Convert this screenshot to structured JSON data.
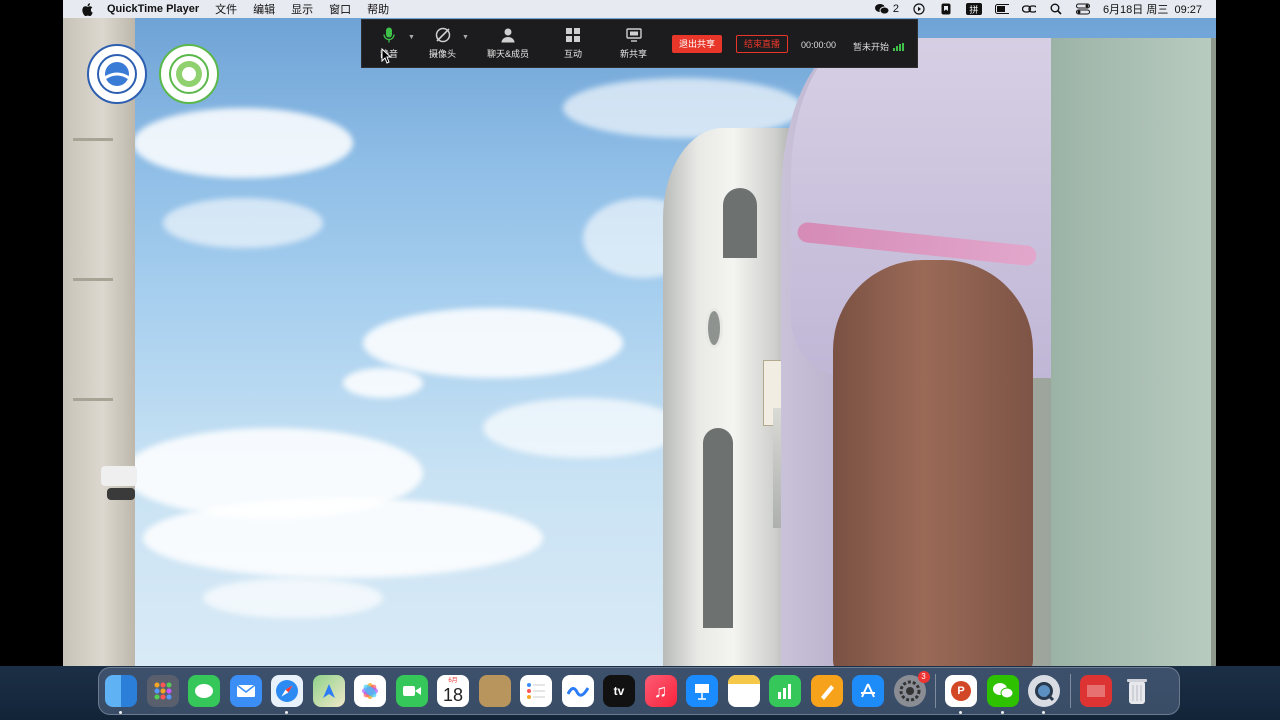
{
  "menubar": {
    "app_name": "QuickTime Player",
    "items": [
      "文件",
      "编辑",
      "显示",
      "窗口",
      "帮助"
    ],
    "status_count": "2",
    "input_method": "拼",
    "datetime": "6月18日 周三  09:27"
  },
  "toolbar": {
    "items": [
      {
        "label": "静音",
        "icon": "microphone-icon"
      },
      {
        "label": "摄像头",
        "icon": "camera-off-icon"
      },
      {
        "label": "聊天&成员",
        "icon": "person-icon"
      },
      {
        "label": "互动",
        "icon": "grid-icon"
      },
      {
        "label": "新共享",
        "icon": "screen-share-icon"
      }
    ],
    "exit_share_label": "退出共享",
    "end_live_label": "结束直播",
    "timer": "00:00:00",
    "status_text": "暂未开始",
    "accent_red": "#e8372a",
    "signal_green": "#3fc24a"
  },
  "dock": {
    "calendar_month": "6月",
    "calendar_day": "18",
    "tv_label": "tv",
    "settings_badge": "3",
    "apps": [
      "finder",
      "launchpad",
      "messages",
      "mail",
      "safari",
      "maps",
      "photos",
      "facetime",
      "calendar",
      "notes-brown",
      "reminders",
      "freeform",
      "apple-tv",
      "music",
      "keynote",
      "notes",
      "numbers",
      "pages",
      "app-store",
      "system-settings",
      "powerpoint",
      "wechat",
      "quicktime",
      "presentation",
      "trash"
    ]
  }
}
